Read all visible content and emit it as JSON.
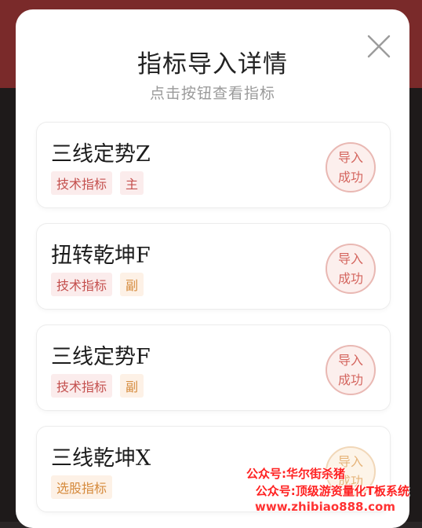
{
  "dialog": {
    "title": "指标导入详情",
    "subtitle": "点击按钮查看指标",
    "close_icon": "close-icon"
  },
  "indicators": [
    {
      "name": "三线定势Z",
      "tags": [
        "技术指标",
        "主"
      ],
      "status": "导入成功"
    },
    {
      "name": "扭转乾坤F",
      "tags": [
        "技术指标",
        "副"
      ],
      "status": "导入成功"
    },
    {
      "name": "三线定势F",
      "tags": [
        "技术指标",
        "副"
      ],
      "status": "导入成功"
    },
    {
      "name": "三线乾坤X",
      "tags": [
        "选股指标"
      ],
      "status": "导入成功"
    }
  ],
  "watermark": {
    "line1": "公众号:华尔街杀猪",
    "line2": "公众号:顶级游资量化T板系统",
    "line3": "www.zhibiao888.com"
  },
  "colors": {
    "accent": "#c4504e",
    "tag_orange": "#d58a3c",
    "watermark": "#ff2222"
  }
}
